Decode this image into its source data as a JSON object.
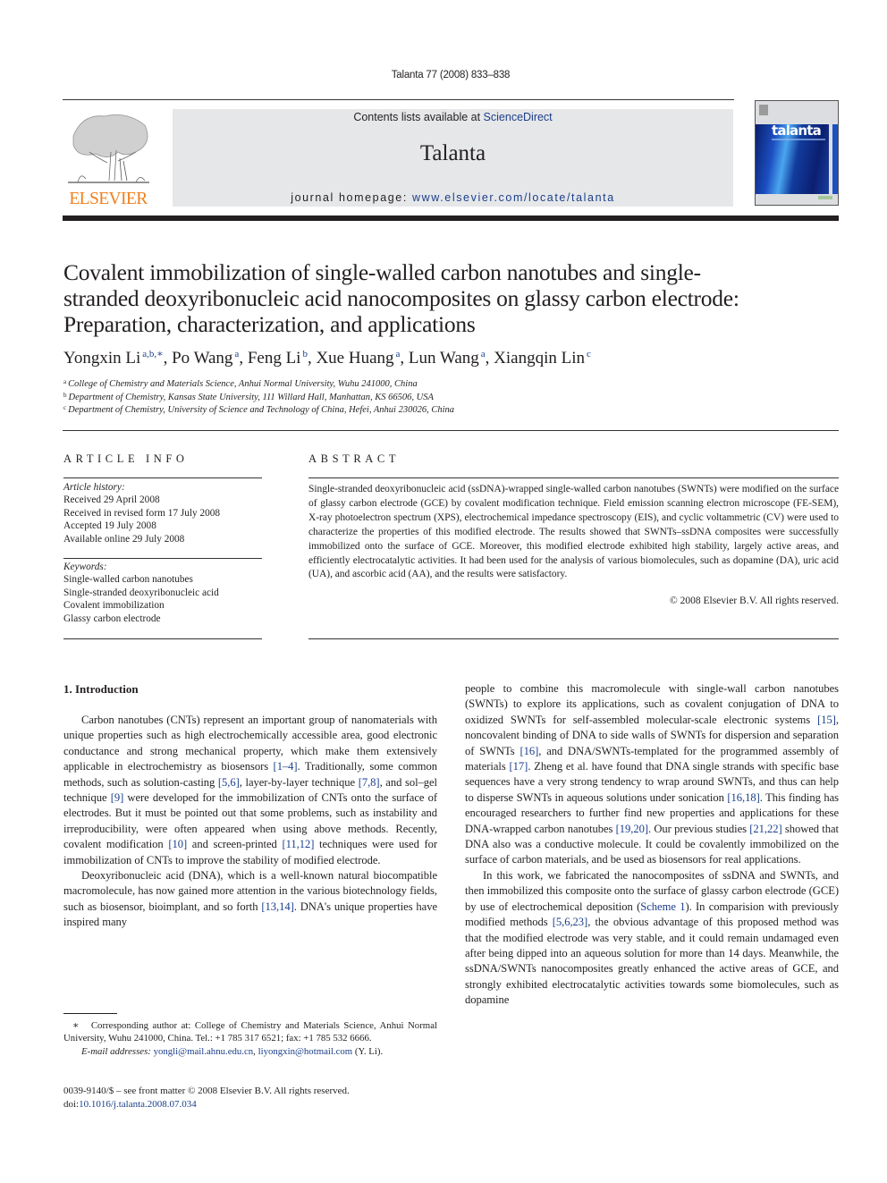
{
  "running_head": "Talanta 77 (2008) 833–838",
  "masthead": {
    "publisher_logo_text": "ELSEVIER",
    "contents_prefix": "Contents lists available at ",
    "contents_link": "ScienceDirect",
    "journal_title": "Talanta",
    "homepage_prefix": "journal homepage: ",
    "homepage_link": "www.elsevier.com/locate/talanta",
    "cover_word": "talanta",
    "colors": {
      "publisher_orange": "#f07f1c",
      "link_blue": "#1b3f8b",
      "banner_gray": "#e6e7e9"
    }
  },
  "article": {
    "title": "Covalent immobilization of single-walled carbon nanotubes and single-stranded deoxyribonucleic acid nanocomposites on glassy carbon electrode: Preparation, characterization, and applications",
    "authors": [
      {
        "name": "Yongxin Li",
        "marks": "a,b,∗"
      },
      {
        "name": "Po Wang",
        "marks": "a"
      },
      {
        "name": "Feng Li",
        "marks": "b"
      },
      {
        "name": "Xue Huang",
        "marks": "a"
      },
      {
        "name": "Lun Wang",
        "marks": "a"
      },
      {
        "name": "Xiangqin Lin",
        "marks": "c"
      }
    ],
    "affiliations": [
      {
        "mark": "a",
        "text": "College of Chemistry and Materials Science, Anhui Normal University, Wuhu 241000, China"
      },
      {
        "mark": "b",
        "text": "Department of Chemistry, Kansas State University, 111 Willard Hall, Manhattan, KS 66506, USA"
      },
      {
        "mark": "c",
        "text": "Department of Chemistry, University of Science and Technology of China, Hefei, Anhui 230026, China"
      }
    ]
  },
  "article_info": {
    "heading": "ARTICLE INFO",
    "history_label": "Article history:",
    "history": [
      "Received 29 April 2008",
      "Received in revised form 17 July 2008",
      "Accepted 19 July 2008",
      "Available online 29 July 2008"
    ],
    "keywords_label": "Keywords:",
    "keywords": [
      "Single-walled carbon nanotubes",
      "Single-stranded deoxyribonucleic acid",
      "Covalent immobilization",
      "Glassy carbon electrode"
    ]
  },
  "abstract": {
    "heading": "ABSTRACT",
    "text": "Single-stranded deoxyribonucleic acid (ssDNA)-wrapped single-walled carbon nanotubes (SWNTs) were modified on the surface of glassy carbon electrode (GCE) by covalent modification technique. Field emission scanning electron microscope (FE-SEM), X-ray photoelectron spectrum (XPS), electrochemical impedance spectroscopy (EIS), and cyclic voltammetric (CV) were used to characterize the properties of this modified electrode. The results showed that SWNTs–ssDNA composites were successfully immobilized onto the surface of GCE. Moreover, this modified electrode exhibited high stability, largely active areas, and efficiently electrocatalytic activities. It had been used for the analysis of various biomolecules, such as dopamine (DA), uric acid (UA), and ascorbic acid (AA), and the results were satisfactory.",
    "copyright": "© 2008 Elsevier B.V. All rights reserved."
  },
  "body": {
    "section_heading": "1.  Introduction",
    "p1": [
      {
        "t": "Carbon nanotubes (CNTs) represent an important group of nanomaterials with unique properties such as high electrochemically accessible area, good electronic conductance and strong mechanical property, which make them extensively applicable in electrochemistry as biosensors "
      },
      {
        "ref": "[1–4]"
      },
      {
        "t": ". Traditionally, some common methods, such as solution-casting "
      },
      {
        "ref": "[5,6]"
      },
      {
        "t": ", layer-by-layer technique "
      },
      {
        "ref": "[7,8]"
      },
      {
        "t": ", and sol–gel technique "
      },
      {
        "ref": "[9]"
      },
      {
        "t": " were developed for the immobilization of CNTs onto the surface of electrodes. But it must be pointed out that some problems, such as instability and irreproducibility, were often appeared when using above methods. Recently, covalent modification "
      },
      {
        "ref": "[10]"
      },
      {
        "t": " and screen-printed "
      },
      {
        "ref": "[11,12]"
      },
      {
        "t": " techniques were used for immobilization of CNTs to improve the stability of modified electrode."
      }
    ],
    "p2": [
      {
        "t": "Deoxyribonucleic acid (DNA), which is a well-known natural biocompatible macromolecule, has now gained more attention in the various biotechnology fields, such as biosensor, bioimplant, and so forth "
      },
      {
        "ref": "[13,14]"
      },
      {
        "t": ". DNA's unique properties have inspired many "
      }
    ],
    "p2_cont": [
      {
        "t": "people to combine this macromolecule with single-wall carbon nanotubes (SWNTs) to explore its applications, such as covalent conjugation of DNA to oxidized SWNTs for self-assembled molecular-scale electronic systems "
      },
      {
        "ref": "[15]"
      },
      {
        "t": ", noncovalent binding of DNA to side walls of SWNTs for dispersion and separation of SWNTs "
      },
      {
        "ref": "[16]"
      },
      {
        "t": ", and DNA/SWNTs-templated for the programmed assembly of materials "
      },
      {
        "ref": "[17]"
      },
      {
        "t": ". Zheng et al. have found that DNA single strands with specific base sequences have a very strong tendency to wrap around SWNTs, and thus can help to disperse SWNTs in aqueous solutions under sonication "
      },
      {
        "ref": "[16,18]"
      },
      {
        "t": ". This finding has encouraged researchers to further find new properties and applications for these DNA-wrapped carbon nanotubes "
      },
      {
        "ref": "[19,20]"
      },
      {
        "t": ". Our previous studies "
      },
      {
        "ref": "[21,22]"
      },
      {
        "t": " showed that DNA also was a conductive molecule. It could be covalently immobilized on the surface of carbon materials, and be used as biosensors for real applications."
      }
    ],
    "p3": [
      {
        "t": "In this work, we fabricated the nanocomposites of ssDNA and SWNTs, and then immobilized this composite onto the surface of glassy carbon electrode (GCE) by use of electrochemical deposition ("
      },
      {
        "ref": "Scheme 1"
      },
      {
        "t": "). In comparision with previously modified methods "
      },
      {
        "ref": "[5,6,23]"
      },
      {
        "t": ", the obvious advantage of this proposed method was that the modified electrode was very stable, and it could remain undamaged even after being dipped into an aqueous solution for more than 14 days. Meanwhile, the ssDNA/SWNTs nanocomposites greatly enhanced the active areas of GCE, and strongly exhibited electrocatalytic activities towards some biomolecules, such as dopamine"
      }
    ]
  },
  "footnote": {
    "mark": "∗",
    "corresponding": "Corresponding author at: College of Chemistry and Materials Science, Anhui Normal University, Wuhu 241000, China. Tel.: +1 785 317 6521; fax: +1 785 532 6666.",
    "email_label": "E-mail addresses:",
    "emails": [
      "yongli@mail.ahnu.edu.cn",
      "liyongxin@hotmail.com"
    ],
    "email_suffix": " (Y. Li)."
  },
  "front_matter": {
    "issn_line": "0039-9140/$ – see front matter © 2008 Elsevier B.V. All rights reserved.",
    "doi_prefix": "doi:",
    "doi": "10.1016/j.talanta.2008.07.034"
  }
}
